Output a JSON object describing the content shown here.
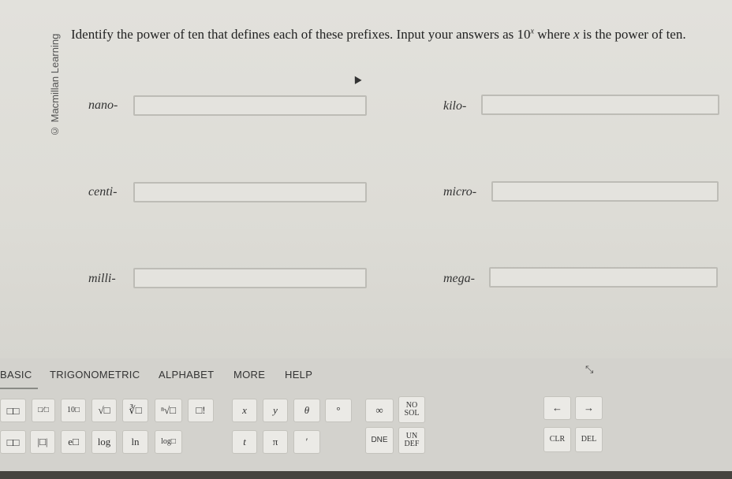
{
  "watermark": "© Macmillan Learning",
  "question": {
    "part1": "Identify the power of ten that defines each of these prefixes. Input your answers as ",
    "base": "10",
    "exp": "x",
    "part2": " where ",
    "var": "x",
    "part3": " is the power of ten."
  },
  "prefixes": {
    "nano": {
      "label": "nano-",
      "value": ""
    },
    "centi": {
      "label": "centi-",
      "value": ""
    },
    "milli": {
      "label": "milli-",
      "value": ""
    },
    "kilo": {
      "label": "kilo-",
      "value": ""
    },
    "micro": {
      "label": "micro-",
      "value": ""
    },
    "mega": {
      "label": "mega-",
      "value": ""
    }
  },
  "tabs": [
    "BASIC",
    "TRIGONOMETRIC",
    "ALPHABET",
    "MORE",
    "HELP"
  ],
  "keys": {
    "superscript": "□□",
    "fraction": "□⁄□",
    "ten_power": "10□",
    "sqrt": "√□",
    "cbrt": "∛□",
    "nth_root": "ⁿ√□",
    "factorial": "□!",
    "x": "x",
    "y": "y",
    "theta": "θ",
    "degree": "°",
    "infinity": "∞",
    "no_sol": "NO SOL",
    "subscript": "□□",
    "abs": "|□|",
    "exp": "e□",
    "log": "log",
    "ln": "ln",
    "log_base": "log□",
    "t": "t",
    "pi": "π",
    "prime": "′",
    "dne": "DNE",
    "undef": "UN DEF",
    "left": "←",
    "right": "→",
    "clr": "CLR",
    "del": "DEL"
  }
}
